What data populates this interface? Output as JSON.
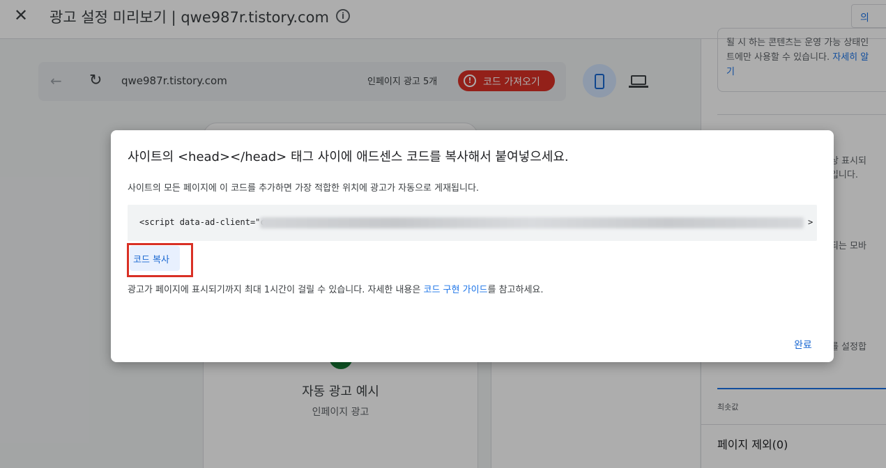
{
  "header": {
    "close_icon": "close-icon",
    "title": "광고 설정 미리보기 | qwe987r.tistory.com",
    "info_icon": "info-icon",
    "feedback_label": "의"
  },
  "browserbar": {
    "url": "qwe987r.tistory.com",
    "inpage_count": "인페이지 광고 5개",
    "get_code_label": "코드 가져오기"
  },
  "preview": {
    "example_title": "자동 광고 예시",
    "example_subtitle": "인페이지 광고"
  },
  "sidepanel": {
    "box_text_1": "될 시 하는 콘텐츠는 운영 가능 상태인",
    "box_text_2": "트에만 사용할 수 있습니다.",
    "box_link": "자세히 알",
    "box_text_3": "기",
    "text_2a": "항상 표시되",
    "text_2b": "고입니다.",
    "text_3": "재되는 모바",
    "text_4": "수를 설정합",
    "min_label": "최솟값",
    "exclude_pages": "페이지 제외(0)"
  },
  "dialog": {
    "title": "사이트의 <head></head> 태그 사이에 애드센스 코드를 복사해서 붙여넣으세요.",
    "description": "사이트의 모든 페이지에 이 코드를 추가하면 가장 적합한 위치에 광고가 자동으로 게재됩니다.",
    "code_start": "<script data-ad-client=\"c",
    "code_end": ">",
    "copy_label": "코드 복사",
    "note_prefix": "광고가 페이지에 표시되기까지 최대 1시간이 걸릴 수 있습니다. 자세한 내용은 ",
    "note_link": "코드 구현 가이드",
    "note_suffix": "를 참고하세요.",
    "done_label": "완료"
  },
  "colors": {
    "accent": "#1a73e8",
    "danger": "#d93025",
    "highlight_frame": "#d93025"
  }
}
